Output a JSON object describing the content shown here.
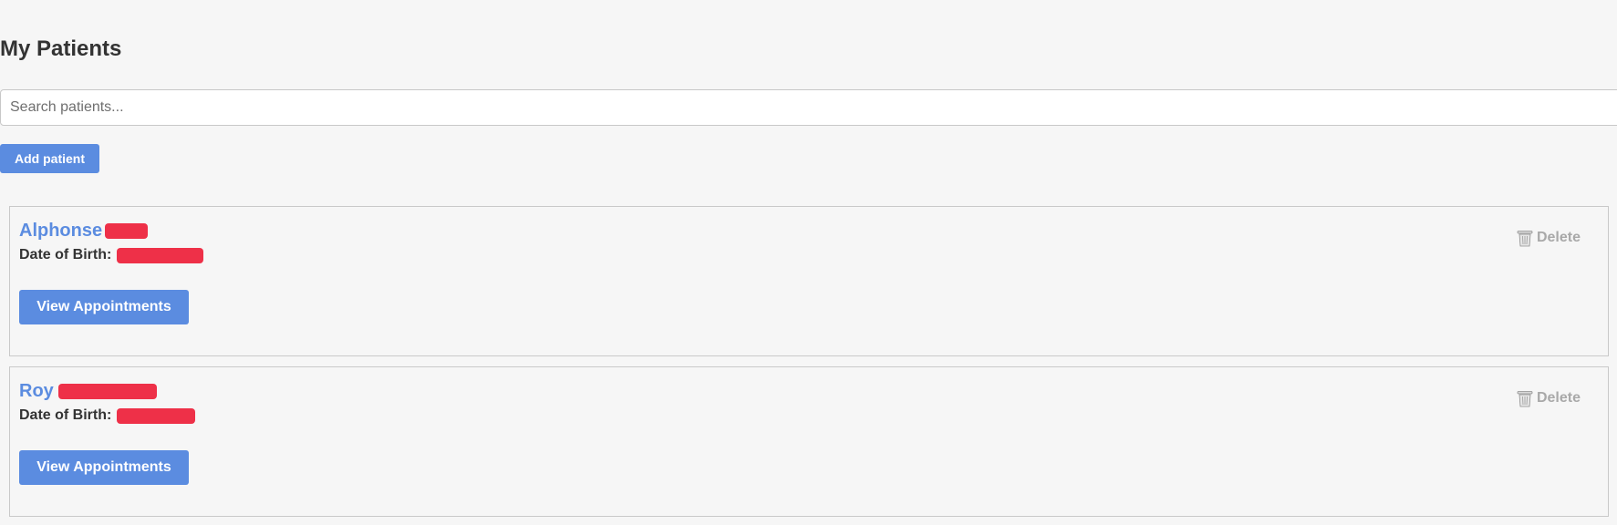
{
  "page": {
    "title": "My Patients"
  },
  "search": {
    "placeholder": "Search patients...",
    "value": ""
  },
  "actions": {
    "add_patient_label": "Add patient"
  },
  "patients": [
    {
      "first_name": "Alphonse",
      "dob_label": "Date of Birth:",
      "view_label": "View Appointments",
      "delete_label": "Delete"
    },
    {
      "first_name": "Roy",
      "dob_label": "Date of Birth:",
      "view_label": "View Appointments",
      "delete_label": "Delete"
    }
  ],
  "colors": {
    "accent": "#5b8ce0",
    "redaction": "#ee3048",
    "muted": "#a9a9a9",
    "background": "#f6f6f6"
  },
  "icons": {
    "delete": "trash-icon"
  }
}
